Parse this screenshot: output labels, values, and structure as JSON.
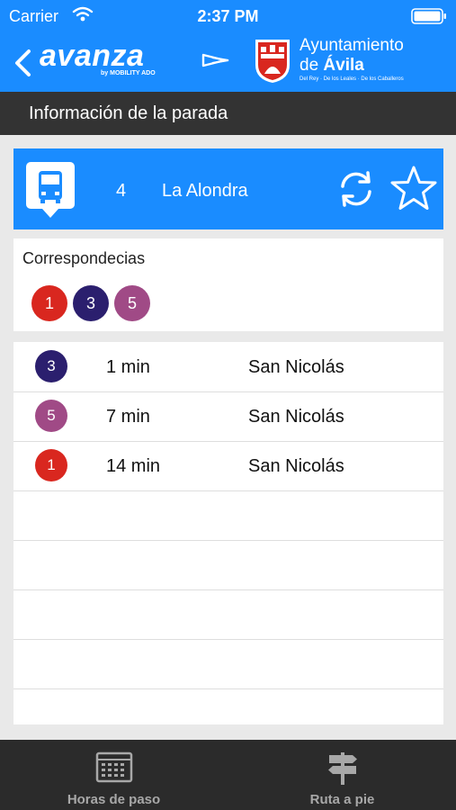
{
  "status": {
    "carrier": "Carrier",
    "time": "2:37 PM"
  },
  "header": {
    "brand": "avanza",
    "brand_sub": "by MOBILITY ADO",
    "city_line1": "Ayuntamiento",
    "city_prefix": "de",
    "city_name": "Ávila",
    "city_tagline": "Del Rey · De los Leales · De los Caballeros"
  },
  "section": {
    "title": "Información de la parada"
  },
  "stop": {
    "number": "4",
    "name": "La Alondra"
  },
  "correspondences": {
    "label": "Correspondecias",
    "lines": [
      {
        "number": "1",
        "color": "#d9271f"
      },
      {
        "number": "3",
        "color": "#2b1f6e"
      },
      {
        "number": "5",
        "color": "#a04a86"
      }
    ]
  },
  "arrivals": [
    {
      "line": "3",
      "color": "#2b1f6e",
      "minutes": "1 min",
      "destination": "San Nicolás"
    },
    {
      "line": "5",
      "color": "#a04a86",
      "minutes": "7 min",
      "destination": "San Nicolás"
    },
    {
      "line": "1",
      "color": "#d9271f",
      "minutes": "14 min",
      "destination": "San Nicolás"
    }
  ],
  "tabs": [
    {
      "label": "Horas de paso",
      "icon": "calendar-icon"
    },
    {
      "label": "Ruta a pie",
      "icon": "signpost-icon"
    }
  ],
  "colors": {
    "primary": "#1a8cff",
    "dark": "#333333",
    "tabbar": "#2b2b2b"
  }
}
